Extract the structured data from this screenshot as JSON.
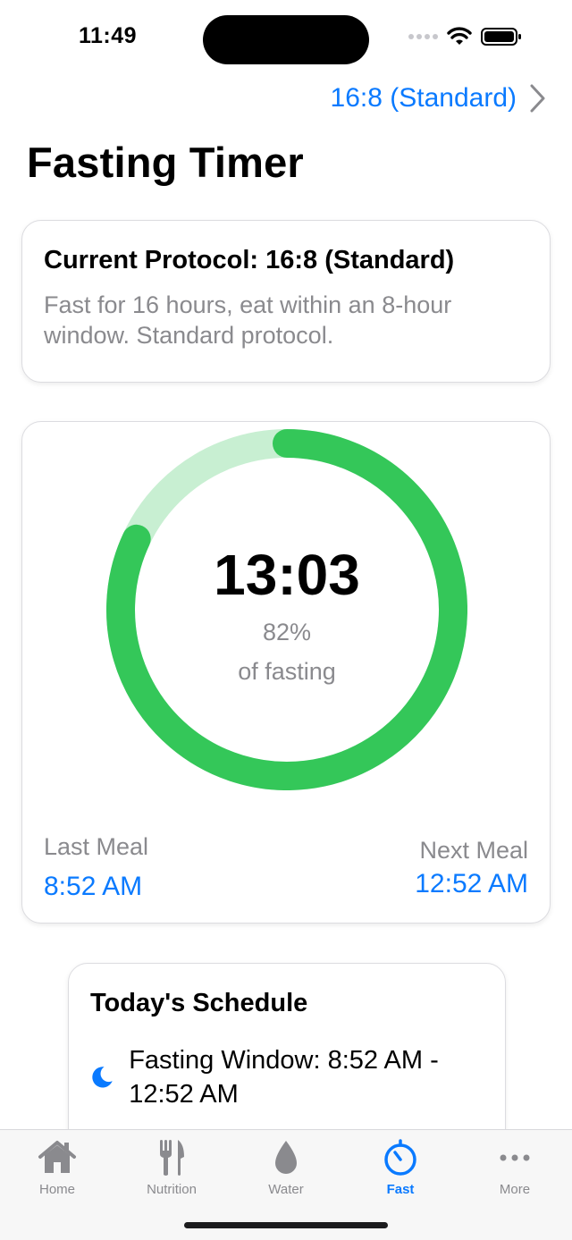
{
  "status_bar": {
    "time": "11:49"
  },
  "header": {
    "protocol_link": "16:8 (Standard)",
    "title": "Fasting Timer"
  },
  "protocol_card": {
    "heading": "Current Protocol: 16:8 (Standard)",
    "description": "Fast for 16 hours, eat within an 8-hour window. Standard protocol."
  },
  "timer": {
    "elapsed": "13:03",
    "percent_label": "82%",
    "progress": 0.82,
    "caption": "of fasting",
    "last_meal_label": "Last Meal",
    "last_meal_time": "8:52 AM",
    "next_meal_label": "Next Meal",
    "next_meal_time": "12:52 AM"
  },
  "schedule": {
    "heading": "Today's Schedule",
    "items": [
      {
        "icon": "moon-icon",
        "text": "Fasting Window: 8:52 AM - 12:52 AM"
      }
    ]
  },
  "tab_bar": {
    "tabs": [
      {
        "label": "Home",
        "icon": "house-icon",
        "active": false
      },
      {
        "label": "Nutrition",
        "icon": "fork-knife-icon",
        "active": false
      },
      {
        "label": "Water",
        "icon": "water-drop-icon",
        "active": false
      },
      {
        "label": "Fast",
        "icon": "timer-icon",
        "active": true
      },
      {
        "label": "More",
        "icon": "ellipsis-icon",
        "active": false
      }
    ]
  },
  "colors": {
    "accent": "#0a7aff",
    "ring_progress": "#34c759",
    "ring_track": "#c8efd2",
    "secondary_text": "#8a8a8e"
  }
}
